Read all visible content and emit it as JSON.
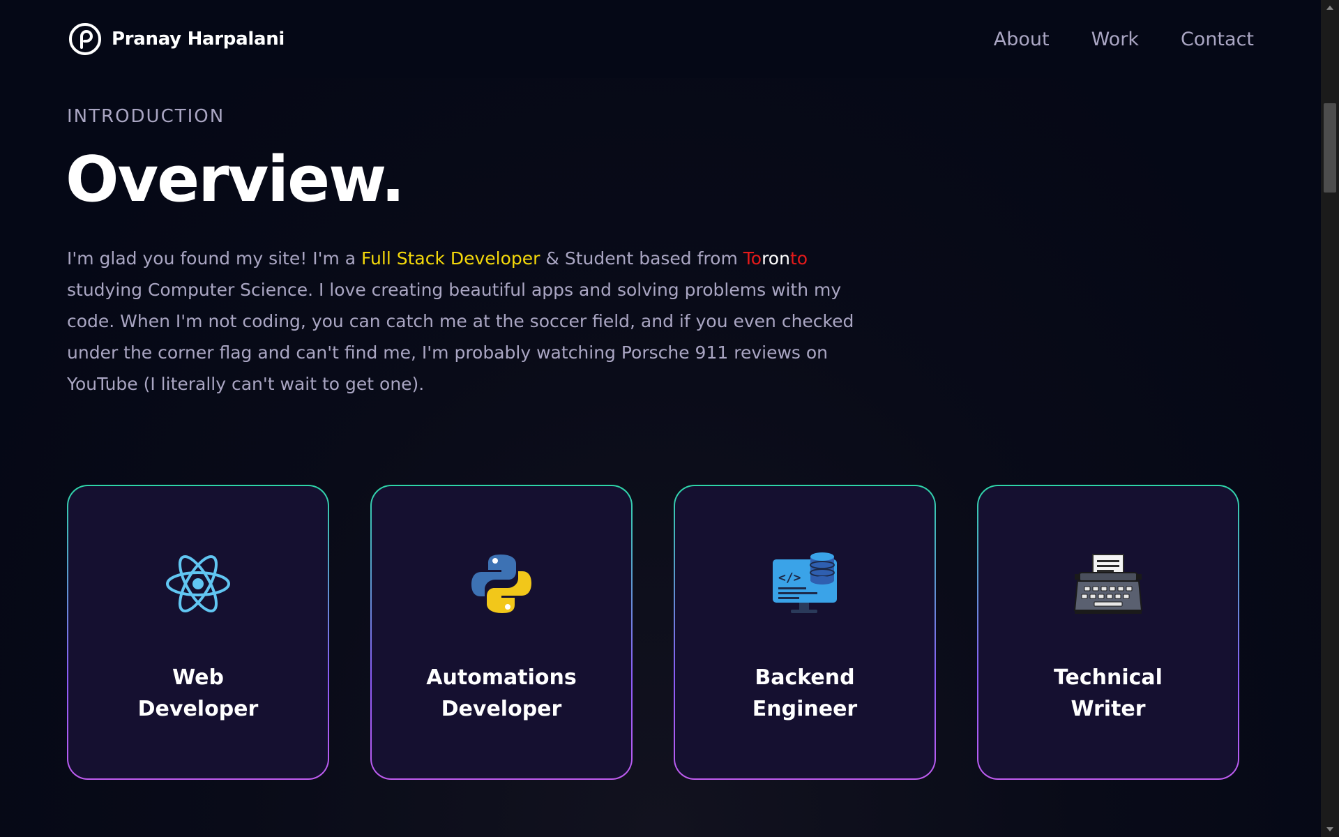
{
  "nav": {
    "brand_name": "Pranay Harpalani",
    "links": [
      {
        "label": "About"
      },
      {
        "label": "Work"
      },
      {
        "label": "Contact"
      }
    ]
  },
  "intro": {
    "eyebrow": "Introduction",
    "title": "Overview.",
    "paragraph": {
      "part1": "I'm glad you found my site! I'm a ",
      "highlight_role": "Full Stack Developer",
      "part2": " & Student based from ",
      "city_seg1": "To",
      "city_seg2": "ron",
      "city_seg3": "to",
      "part3": " studying Computer Science. I love creating beautiful apps and solving problems with my code. When I'm not coding, you can catch me at the soccer field, and if you even checked under the corner flag and can't find me, I'm probably watching Porsche 911 reviews on YouTube (I literally can't wait to get one)."
    },
    "colors": {
      "role_highlight": "#f5d90a",
      "city_red": "#e51a1a",
      "city_white": "#ffffff"
    }
  },
  "services": [
    {
      "title_line1": "Web",
      "title_line2": "Developer",
      "icon": "react-icon"
    },
    {
      "title_line1": "Automations",
      "title_line2": "Developer",
      "icon": "python-icon"
    },
    {
      "title_line1": "Backend",
      "title_line2": "Engineer",
      "icon": "backend-server-icon"
    },
    {
      "title_line1": "Technical",
      "title_line2": "Writer",
      "icon": "typewriter-icon"
    }
  ],
  "theme": {
    "background": "#050816",
    "card_background": "#151030",
    "card_border_top": "#2ed6a8",
    "card_border_bottom": "#c05cf0",
    "secondary_text": "#aaa6c3"
  }
}
